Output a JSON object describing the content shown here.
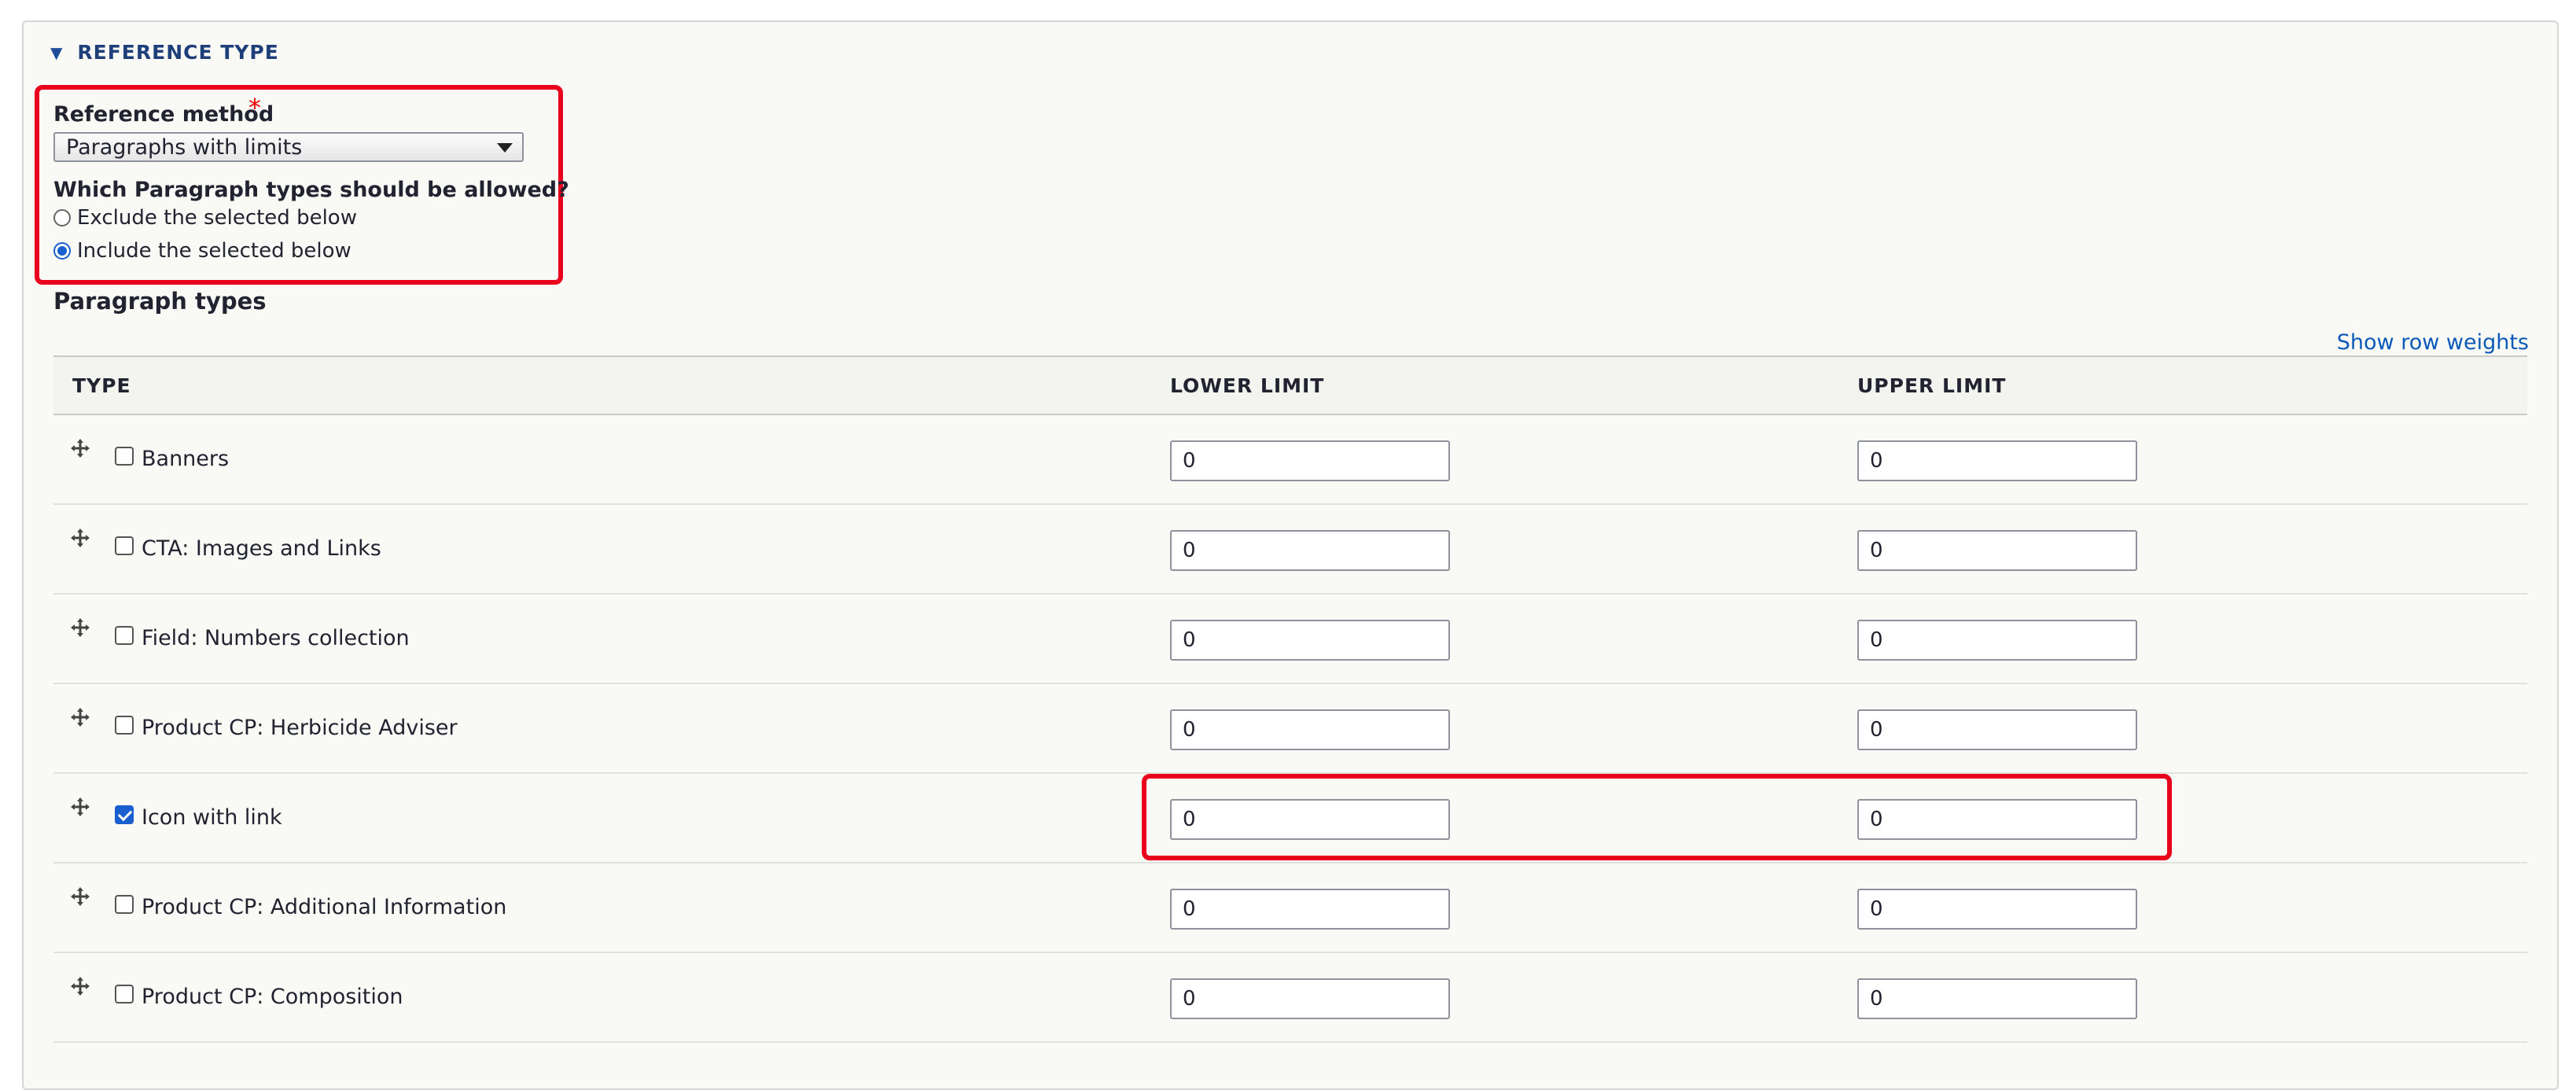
{
  "details": {
    "summary": "REFERENCE TYPE"
  },
  "reference_method": {
    "label": "Reference method",
    "required_marker": "*",
    "selected": "Paragraphs with limits"
  },
  "allowed": {
    "question": "Which Paragraph types should be allowed?",
    "options": [
      {
        "label": "Exclude the selected below",
        "checked": false
      },
      {
        "label": "Include the selected below",
        "checked": true
      }
    ]
  },
  "paragraph_types": {
    "title": "Paragraph types",
    "show_weights_link": "Show row weights",
    "columns": [
      "TYPE",
      "LOWER LIMIT",
      "UPPER LIMIT"
    ],
    "rows": [
      {
        "label": "Banners",
        "checked": false,
        "lower": "0",
        "upper": "0"
      },
      {
        "label": "CTA: Images and Links",
        "checked": false,
        "lower": "0",
        "upper": "0"
      },
      {
        "label": "Field: Numbers collection",
        "checked": false,
        "lower": "0",
        "upper": "0"
      },
      {
        "label": "Product CP: Herbicide Adviser",
        "checked": false,
        "lower": "0",
        "upper": "0"
      },
      {
        "label": "Icon with link",
        "checked": true,
        "lower": "0",
        "upper": "0"
      },
      {
        "label": "Product CP: Additional Information",
        "checked": false,
        "lower": "0",
        "upper": "0"
      },
      {
        "label": "Product CP: Composition",
        "checked": false,
        "lower": "0",
        "upper": "0"
      }
    ]
  },
  "colors": {
    "highlight": "#e8001c",
    "accent": "#1a5fd0",
    "link": "#0b5ab8"
  }
}
